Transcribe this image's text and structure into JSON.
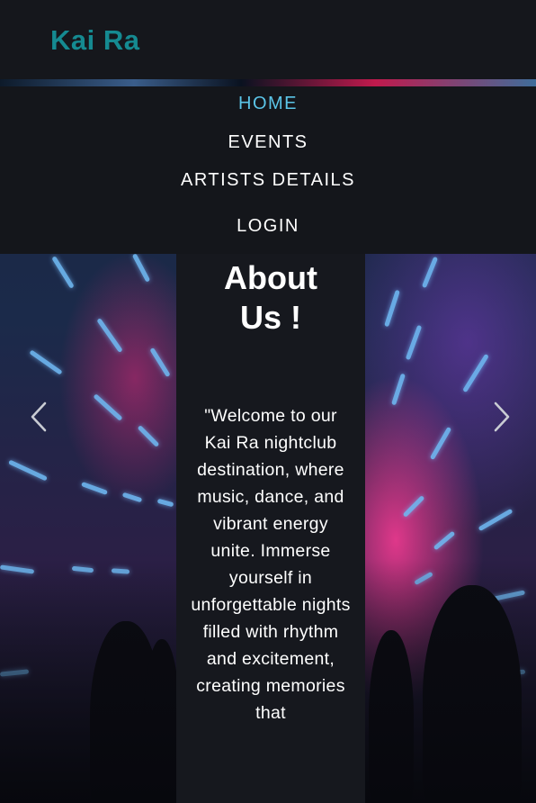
{
  "header": {
    "brand": "Kai Ra"
  },
  "nav": {
    "home": "HOME",
    "events": "EVENTS",
    "artists": "ARTISTS DETAILS",
    "login": "LOGIN",
    "active": "home"
  },
  "carousel": {
    "prev_icon": "chevron-left-icon",
    "next_icon": "chevron-right-icon",
    "background": "nightclub crowd with neon ceiling lights"
  },
  "about": {
    "title": "About Us !",
    "body": "\"Welcome to our Kai Ra nightclub destination, where music, dance, and vibrant energy unite. Immerse yourself in unforgettable nights filled with rhythm and excitement, creating memories that"
  },
  "colors": {
    "brand": "#158a91",
    "nav_active": "#5bc5e8",
    "panel": "#14161b"
  }
}
